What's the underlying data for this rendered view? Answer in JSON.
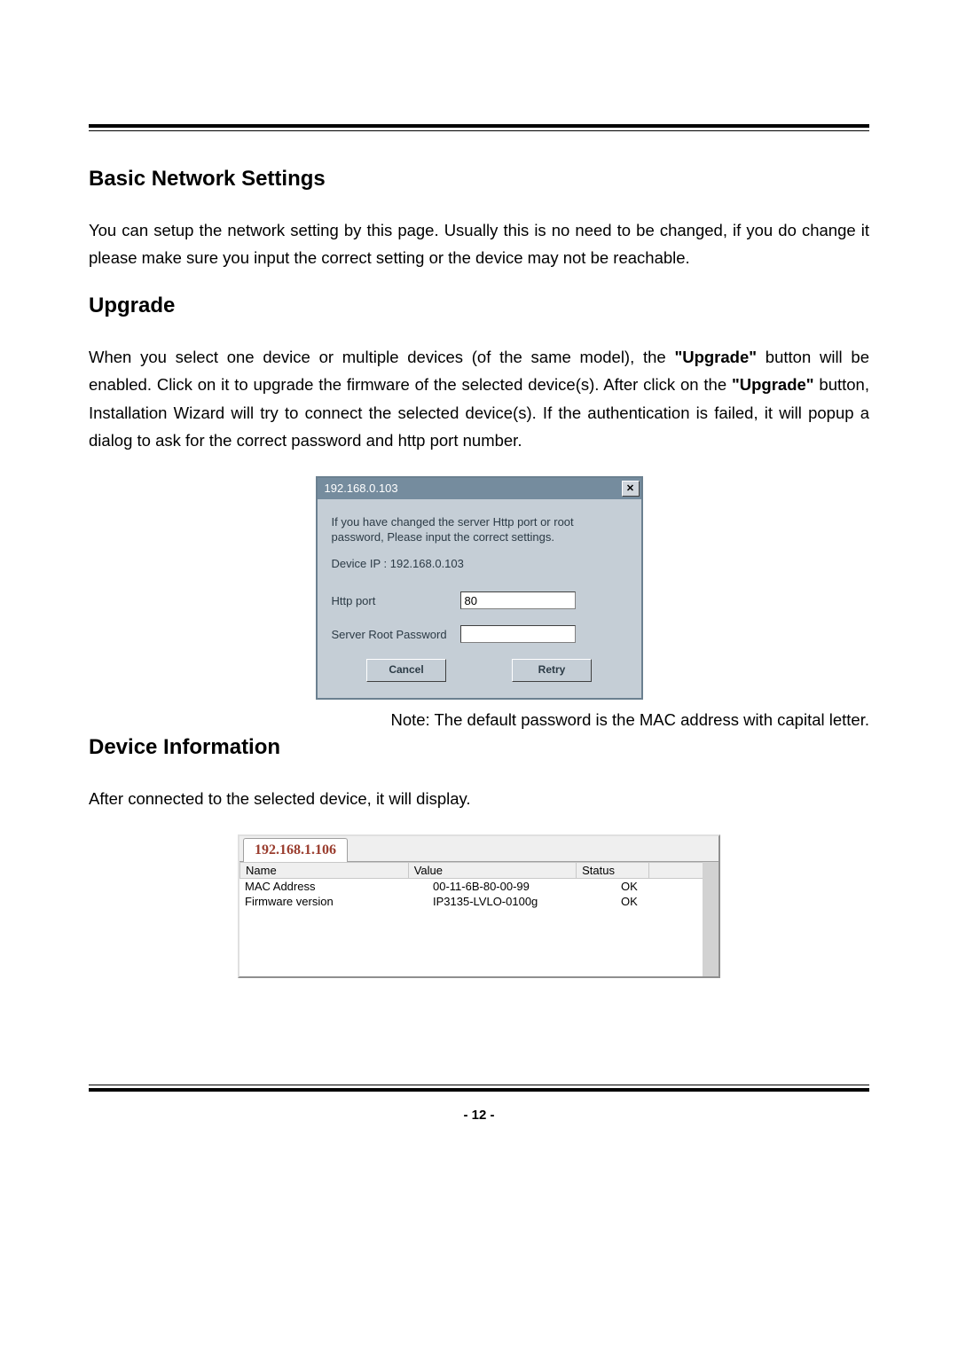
{
  "sections": {
    "basic_title": "Basic Network Settings",
    "basic_body": "You can setup the network setting by this page. Usually this is no need to be changed, if you do change it please make sure you input the correct setting or the device may not be reachable.",
    "upgrade_title": "Upgrade",
    "upgrade_body_pre": "When you select one device or multiple devices (of the same model), the ",
    "upgrade_body_bold1": "\"Upgrade\"",
    "upgrade_body_mid": " button will be enabled. Click on it to upgrade the firmware of the selected device(s). After click on the ",
    "upgrade_body_bold2": "\"Upgrade\"",
    "upgrade_body_post": " button, Installation Wizard will try to connect the selected device(s). If the authentication is failed, it will popup a dialog to ask for the correct password and http port number.",
    "note": "Note: The default password is the MAC address with capital letter.",
    "devinfo_title": "Device Information",
    "devinfo_body": "After connected to the selected device, it will display."
  },
  "dialog": {
    "title": "192.168.0.103",
    "message": "If you have changed the server Http port or root password, Please input the correct settings.",
    "device_ip_label": "Device IP : 192.168.0.103",
    "http_port_label": "Http port",
    "http_port_value": "80",
    "password_label": "Server Root Password",
    "password_value": "",
    "cancel_label": "Cancel",
    "retry_label": "Retry"
  },
  "devinfo_panel": {
    "tab": "192.168.1.106",
    "headers": {
      "name": "Name",
      "value": "Value",
      "status": "Status"
    },
    "rows": [
      {
        "name": "MAC Address",
        "value": "00-11-6B-80-00-99",
        "status": "OK"
      },
      {
        "name": "Firmware version",
        "value": "IP3135-LVLO-0100g",
        "status": "OK"
      }
    ]
  },
  "page_number": "- 12 -"
}
